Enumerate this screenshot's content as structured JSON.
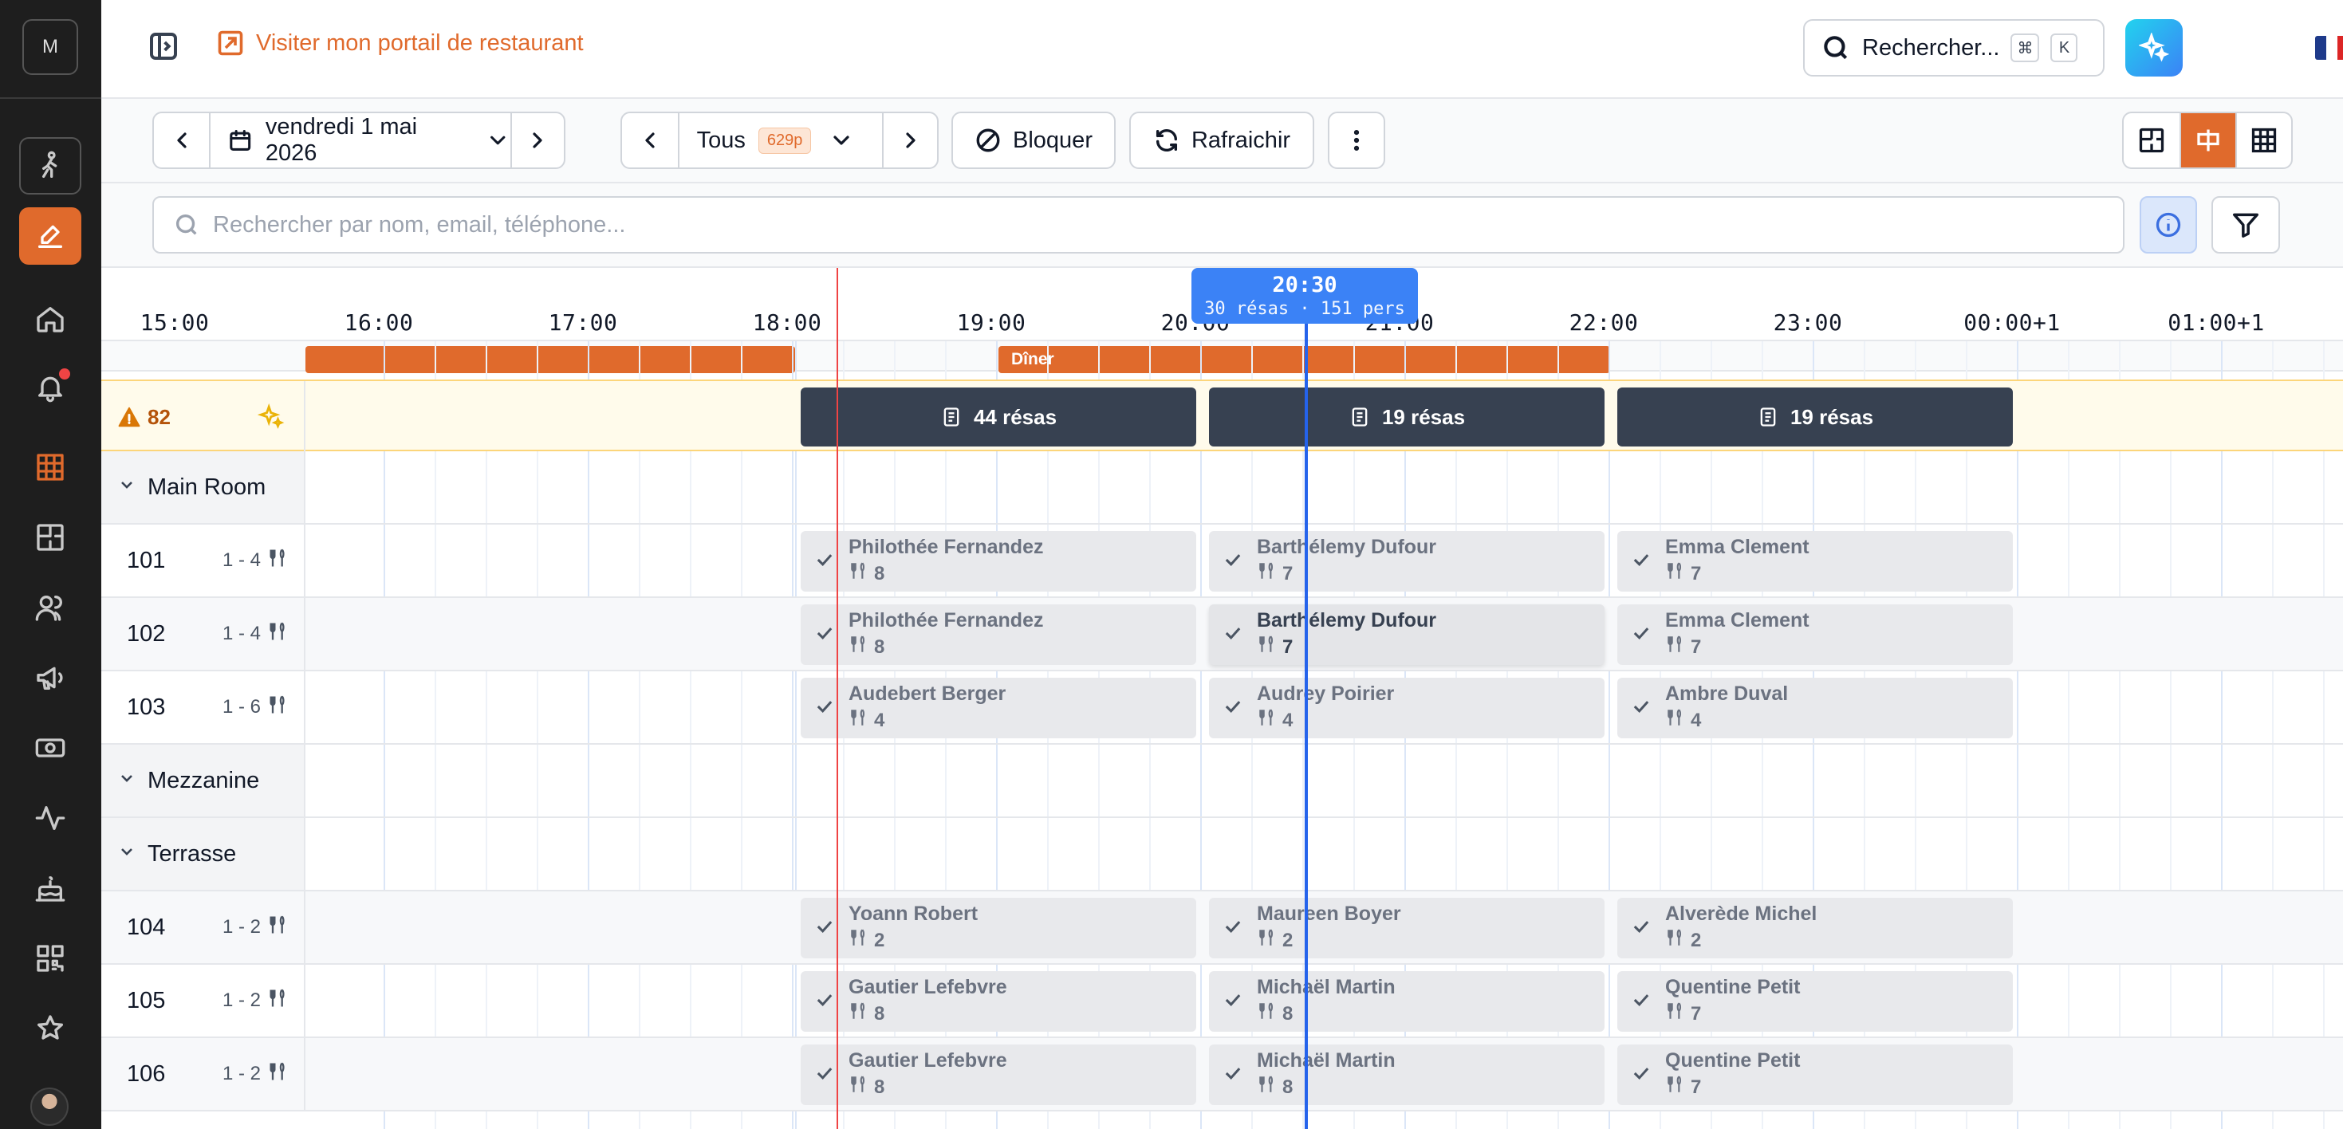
{
  "rail": {
    "avatar_initial": "M",
    "items": [
      "walk-in",
      "edit",
      "home",
      "notifications",
      "floor-grid",
      "floor-plan",
      "customers",
      "marketing",
      "payments",
      "analytics",
      "cake",
      "qr-code",
      "reviews"
    ]
  },
  "topbar": {
    "portal_link": "Visiter mon portail de restaurant",
    "search_label": "Rechercher...",
    "kbd_cmd": "⌘",
    "kbd_k": "K",
    "flag_colors": [
      "#1e3a8a",
      "#ffffff",
      "#dc2626"
    ]
  },
  "toolbar": {
    "date_label": "vendredi 1 mai 2026",
    "filter_label": "Tous",
    "filter_badge": "629p",
    "block_label": "Bloquer",
    "refresh_label": "Rafraichir"
  },
  "search": {
    "placeholder": "Rechercher par nom, email, téléphone..."
  },
  "timeline": {
    "hours": [
      "15:00",
      "16:00",
      "17:00",
      "18:00",
      "19:00",
      "20:00",
      "21:00",
      "22:00",
      "23:00",
      "00:00+1",
      "01:00+1"
    ],
    "services": [
      {
        "label": ""
      },
      {
        "label": "Dîner"
      }
    ],
    "summary": {
      "count": "82",
      "blocks": [
        "44 résas",
        "19 résas",
        "19 résas"
      ]
    },
    "cursor": {
      "time": "20:30",
      "detail": "30 résas · 151 pers"
    },
    "rows": [
      {
        "type": "section",
        "label": "Main Room"
      },
      {
        "type": "table",
        "num": "101",
        "cap": "1 - 4",
        "res": [
          {
            "name": "Philothée Fernandez",
            "pers": "8"
          },
          {
            "name": "Barthélemy Dufour",
            "pers": "7"
          },
          {
            "name": "Emma Clement",
            "pers": "7"
          }
        ]
      },
      {
        "type": "table",
        "num": "102",
        "cap": "1 - 4",
        "res": [
          {
            "name": "Philothée Fernandez",
            "pers": "8"
          },
          {
            "name": "Barthélemy Dufour",
            "pers": "7"
          },
          {
            "name": "Emma Clement",
            "pers": "7"
          }
        ]
      },
      {
        "type": "table",
        "num": "103",
        "cap": "1 - 6",
        "res": [
          {
            "name": "Audebert Berger",
            "pers": "4"
          },
          {
            "name": "Audrey Poirier",
            "pers": "4"
          },
          {
            "name": "Ambre Duval",
            "pers": "4"
          }
        ]
      },
      {
        "type": "section",
        "label": "Mezzanine"
      },
      {
        "type": "section",
        "label": "Terrasse"
      },
      {
        "type": "table",
        "num": "104",
        "cap": "1 - 2",
        "res": [
          {
            "name": "Yoann Robert",
            "pers": "2"
          },
          {
            "name": "Maureen Boyer",
            "pers": "2"
          },
          {
            "name": "Alverède Michel",
            "pers": "2"
          }
        ]
      },
      {
        "type": "table",
        "num": "105",
        "cap": "1 - 2",
        "res": [
          {
            "name": "Gautier Lefebvre",
            "pers": "8"
          },
          {
            "name": "Michaël Martin",
            "pers": "8"
          },
          {
            "name": "Quentine Petit",
            "pers": "7"
          }
        ]
      },
      {
        "type": "table",
        "num": "106",
        "cap": "1 - 2",
        "res": [
          {
            "name": "Gautier Lefebvre",
            "pers": "8"
          },
          {
            "name": "Michaël Martin",
            "pers": "8"
          },
          {
            "name": "Quentine Petit",
            "pers": "7"
          }
        ]
      }
    ]
  },
  "colors": {
    "brand": "#e06a2c",
    "cursor": "#3b82f6",
    "now": "#ef4444"
  }
}
